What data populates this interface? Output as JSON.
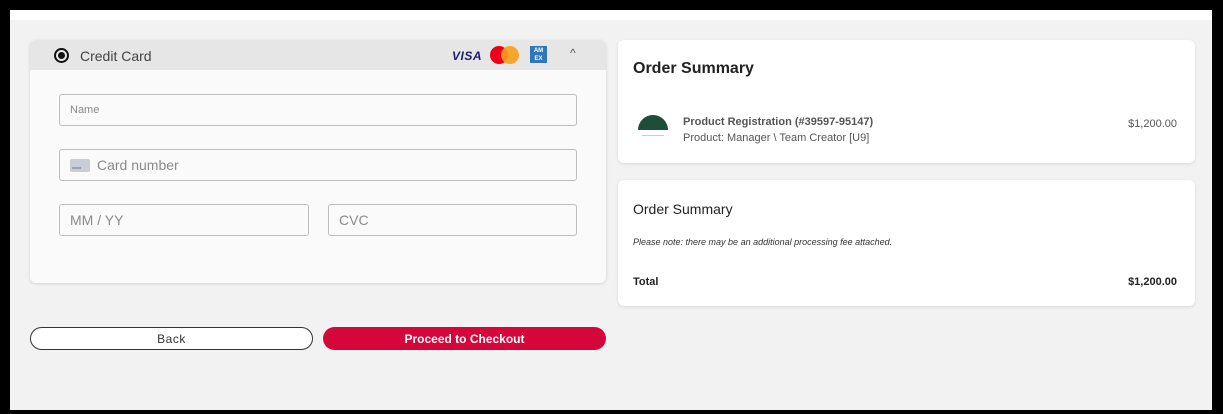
{
  "payment": {
    "method_label": "Credit Card",
    "selected": true,
    "brands": {
      "visa": "VISA",
      "mastercard_icon": "mastercard-icon",
      "amex": "AM EX"
    },
    "collapse_icon": "^",
    "fields": {
      "name_placeholder": "Name",
      "card_placeholder": "Card number",
      "expiry_placeholder": "MM / YY",
      "cvc_placeholder": "CVC"
    }
  },
  "buttons": {
    "back_label": "Back",
    "proceed_label": "Proceed to Checkout"
  },
  "order_summary_1": {
    "title": "Order Summary",
    "item": {
      "name": "Product Registration (#39597-95147)",
      "subtitle": "Product: Manager \\ Team Creator [U9]",
      "price": "$1,200.00"
    }
  },
  "order_summary_2": {
    "title": "Order Summary",
    "note": "Please note: there may be an additional processing fee attached.",
    "total_label": "Total",
    "total_value": "$1,200.00"
  },
  "colors": {
    "accent": "#d5063a",
    "header_bg": "#e6e6e6"
  }
}
